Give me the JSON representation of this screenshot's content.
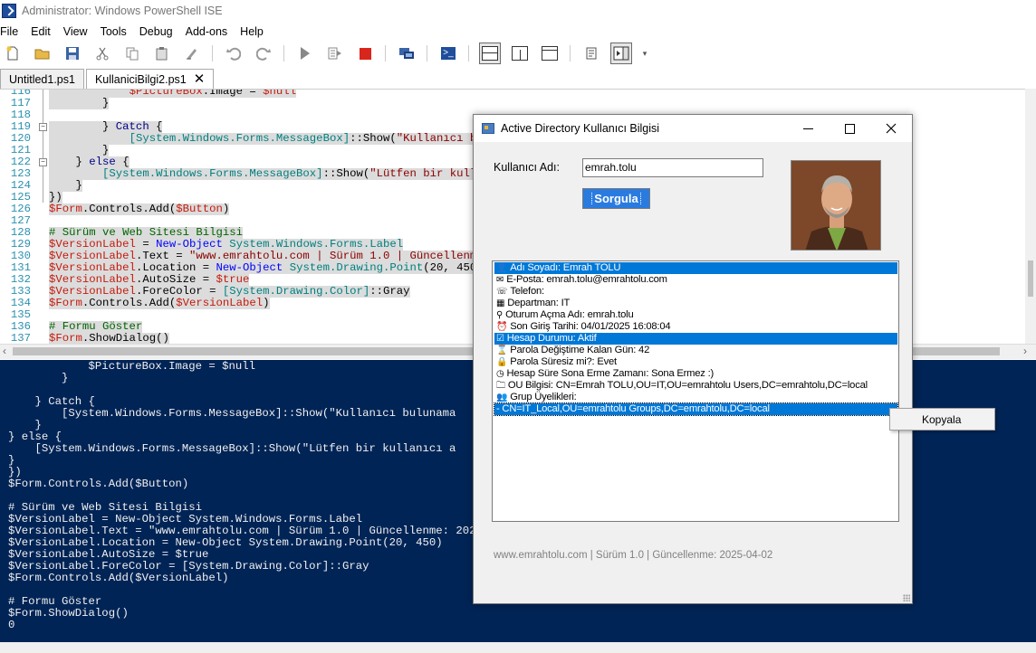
{
  "window": {
    "title": "Administrator: Windows PowerShell ISE"
  },
  "menu": [
    "File",
    "Edit",
    "View",
    "Tools",
    "Debug",
    "Add-ons",
    "Help"
  ],
  "toolbar": [
    "new-file-icon",
    "open-icon",
    "save-icon",
    "cut-icon",
    "copy-icon",
    "paste-icon",
    "clear-icon",
    "undo-icon",
    "redo-icon",
    "run-icon",
    "run-selection-icon",
    "stop-icon",
    "remote-icon",
    "powershell-icon",
    "layout-top-icon",
    "layout-right-icon",
    "layout-max-icon",
    "show-commands-icon",
    "show-addons-icon",
    "overflow-icon"
  ],
  "tabs": [
    {
      "label": "Untitled1.ps1",
      "active": false
    },
    {
      "label": "KullaniciBilgi2.ps1",
      "active": true,
      "close": "✕"
    }
  ],
  "editor": {
    "lines": [
      {
        "n": "116",
        "code": "            $PictureBox.Image = $null"
      },
      {
        "n": "117",
        "code": "        }"
      },
      {
        "n": "118",
        "code": ""
      },
      {
        "n": "119",
        "code": "        } Catch {"
      },
      {
        "n": "120",
        "code": "            [System.Windows.Forms.MessageBox]::Show(\"Kullanıcı bu"
      },
      {
        "n": "121",
        "code": "        }"
      },
      {
        "n": "122",
        "code": "    } else {"
      },
      {
        "n": "123",
        "code": "        [System.Windows.Forms.MessageBox]::Show(\"Lütfen bir kulla"
      },
      {
        "n": "124",
        "code": "    }"
      },
      {
        "n": "125",
        "code": "})"
      },
      {
        "n": "126",
        "code": "$Form.Controls.Add($Button)"
      },
      {
        "n": "127",
        "code": ""
      },
      {
        "n": "128",
        "code": "# Sürüm ve Web Sitesi Bilgisi"
      },
      {
        "n": "129",
        "code": "$VersionLabel = New-Object System.Windows.Forms.Label"
      },
      {
        "n": "130",
        "code": "$VersionLabel.Text = \"www.emrahtolu.com | Sürüm 1.0 | Güncellenme"
      },
      {
        "n": "131",
        "code": "$VersionLabel.Location = New-Object System.Drawing.Point(20, 450)"
      },
      {
        "n": "132",
        "code": "$VersionLabel.AutoSize = $true"
      },
      {
        "n": "133",
        "code": "$VersionLabel.ForeColor = [System.Drawing.Color]::Gray"
      },
      {
        "n": "134",
        "code": "$Form.Controls.Add($VersionLabel)"
      },
      {
        "n": "135",
        "code": ""
      },
      {
        "n": "136",
        "code": "# Formu Göster"
      },
      {
        "n": "137",
        "code": "$Form.ShowDialog()"
      }
    ]
  },
  "console": {
    "lines": [
      "            $PictureBox.Image = $null",
      "        }",
      "",
      "    } Catch {",
      "        [System.Windows.Forms.MessageBox]::Show(\"Kullanıcı bulunama",
      "    }",
      "} else {",
      "    [System.Windows.Forms.MessageBox]::Show(\"Lütfen bir kullanıcı a",
      "}",
      "})",
      "$Form.Controls.Add($Button)",
      "",
      "# Sürüm ve Web Sitesi Bilgisi",
      "$VersionLabel = New-Object System.Windows.Forms.Label",
      "$VersionLabel.Text = \"www.emrahtolu.com | Sürüm 1.0 | Güncellenme: 2025",
      "$VersionLabel.Location = New-Object System.Drawing.Point(20, 450)",
      "$VersionLabel.AutoSize = $true",
      "$VersionLabel.ForeColor = [System.Drawing.Color]::Gray",
      "$Form.Controls.Add($VersionLabel)",
      "",
      "# Formu Göster",
      "$Form.ShowDialog()",
      "0"
    ]
  },
  "dialog": {
    "title": "Active Directory Kullanıcı Bilgisi",
    "username_label": "Kullanıcı Adı:",
    "username_value": "emrah.tolu",
    "query_button": "Sorgula",
    "footer": "www.emrahtolu.com | Sürüm 1.0 | Güncellenme: 2025-04-02",
    "items": [
      {
        "icon": "👤",
        "text": "Adı Soyadı: Emrah TOLU",
        "selected": true
      },
      {
        "icon": "✉",
        "text": "E-Posta: emrah.tolu@emrahtolu.com",
        "selected": false
      },
      {
        "icon": "☏",
        "text": "Telefon:",
        "selected": false
      },
      {
        "icon": "▦",
        "text": "Departman: IT",
        "selected": false
      },
      {
        "icon": "⚲",
        "text": "Oturum Açma Adı: emrah.tolu",
        "selected": false
      },
      {
        "icon": "⏰",
        "text": "Son Giriş Tarihi: 04/01/2025 16:08:04",
        "selected": false
      },
      {
        "icon": "☑",
        "text": "Hesap Durumu: Aktif",
        "selected": true
      },
      {
        "icon": "⌛",
        "text": "Parola Değiştime Kalan Gün: 42",
        "selected": false
      },
      {
        "icon": "🔒",
        "text": "Parola Süresiz mi?: Evet",
        "selected": false
      },
      {
        "icon": "◷",
        "text": "Hesap Süre Sona Erme Zamanı: Sona Ermez :)",
        "selected": false
      },
      {
        "icon": "🗀",
        "text": "OU Bilgisi: CN=Emrah TOLU,OU=IT,OU=emrahtolu Users,DC=emrahtolu,DC=local",
        "selected": false
      },
      {
        "icon": "👥",
        "text": "Grup Üyelikleri:",
        "selected": false
      },
      {
        "icon": "",
        "text": " - CN=IT_Local,OU=emrahtolu Groups,DC=emrahtolu,DC=local",
        "selected": true
      }
    ]
  },
  "context_menu": {
    "items": [
      "Kopyala"
    ]
  },
  "colors": {
    "console_bg": "#012456",
    "selection": "#0078d7",
    "accent_button": "#2a7be0"
  }
}
